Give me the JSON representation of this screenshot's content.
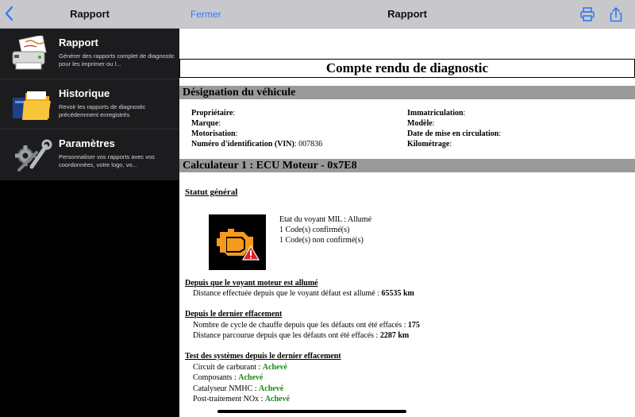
{
  "sidebar": {
    "header_title": "Rapport",
    "items": [
      {
        "title": "Rapport",
        "desc": "Générer des rapports complet de diagnostic pour les imprimer ou l..."
      },
      {
        "title": "Historique",
        "desc": "Revoir les rapports de diagnostic précédemment enregistrés"
      },
      {
        "title": "Paramètres",
        "desc": "Personnaliser vos rapports avec vos coordonnées, votre logo, vo..."
      }
    ]
  },
  "main": {
    "close_label": "Fermer",
    "title": "Rapport"
  },
  "colors": {
    "accent": "#2f7bf5",
    "header_bg": "#c8c8cc",
    "section_bar": "#9a9a9a",
    "success": "#1a8a1a",
    "mil_orange": "#f59a1c",
    "warning_red": "#e02020"
  },
  "report": {
    "title": "Compte rendu de diagnostic",
    "vehicle_section": "Désignation du véhicule",
    "vehicle": {
      "proprietaire_label": "Propriétaire",
      "marque_label": "Marque",
      "motorisation_label": "Motorisation",
      "vin_label": "Numéro d'identification (VIN)",
      "vin_value": "007836",
      "immat_label": "Immatriculation",
      "modele_label": "Modèle",
      "date_label": "Date de mise en circulation",
      "km_label": "Kilométrage"
    },
    "ecu_section": "Calculateur 1 : ECU Moteur - 0x7E8",
    "status_title": "Statut général",
    "mil_lines": [
      "Etat du voyant MIL : Allumé",
      "1 Code(s) confirmé(s)",
      "1 Code(s) non confirmé(s)"
    ],
    "since_mil": {
      "title": "Depuis que le voyant moteur est allumé",
      "line_label": "Distance effectuée depuis que le voyant défaut est allumé :",
      "line_value": "65535 km"
    },
    "since_clear": {
      "title": "Depuis le dernier effacement",
      "line1_label": "Nombre de cycle de chauffe depuis que les défauts ont été effacés :",
      "line1_value": "175",
      "line2_label": "Distance parcourue depuis que les défauts ont été effacés :",
      "line2_value": "2287 km"
    },
    "tests": {
      "title": "Test des systèmes depuis le dernier effacement",
      "items": [
        {
          "label": "Circuit de carburant :",
          "status": "Achevé"
        },
        {
          "label": "Composants :",
          "status": "Achevé"
        },
        {
          "label": "Catalyseur NMHC :",
          "status": "Achevé"
        },
        {
          "label": "Post-traitement NOx :",
          "status": "Achevé"
        }
      ]
    }
  },
  "icons": {
    "back": "chevron-left-icon",
    "print": "printer-icon",
    "share": "share-icon",
    "rapport": "report-printer-icon",
    "historique": "folder-icon",
    "parametres": "tools-icon",
    "mil": "check-engine-icon"
  }
}
